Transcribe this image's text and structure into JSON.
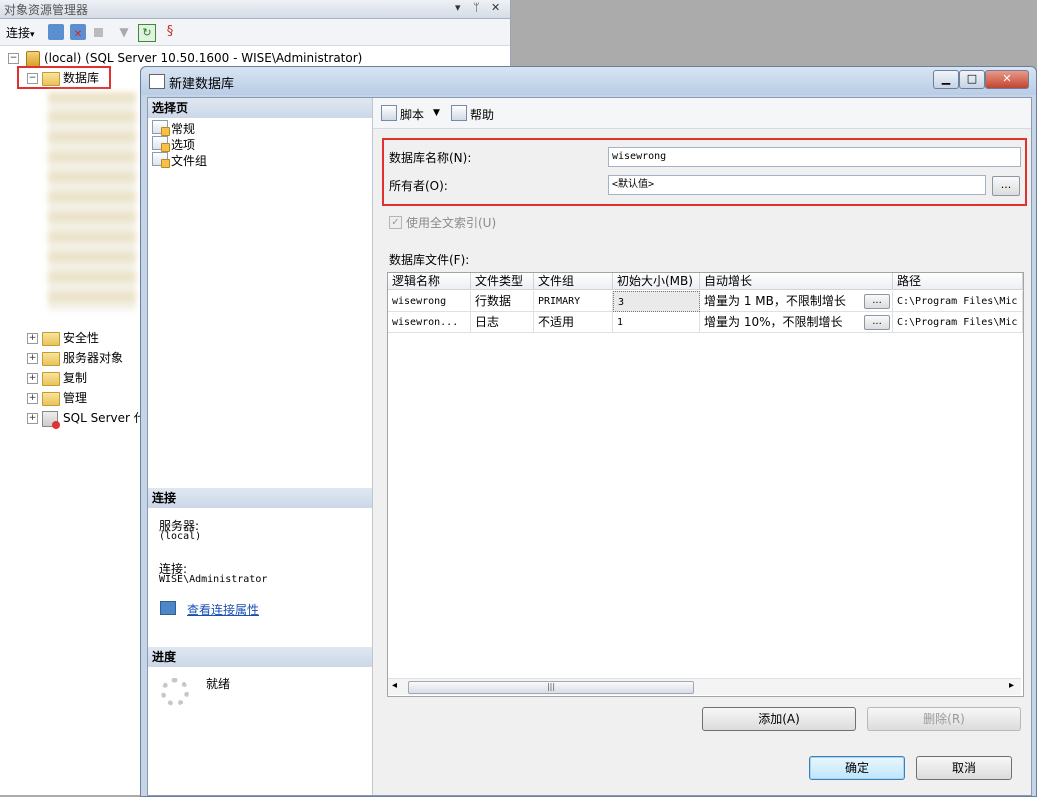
{
  "object_explorer": {
    "title": "对象资源管理器",
    "title_controls": [
      "▾",
      "ᛘ",
      "✕"
    ],
    "toolbar": {
      "connect_label": "连接",
      "connect_arrow": "▾"
    },
    "tree": {
      "server": "(local) (SQL Server 10.50.1600 - WISE\\Administrator)",
      "databases": "数据库",
      "nodes": [
        "安全性",
        "服务器对象",
        "复制",
        "管理",
        "SQL Server 代"
      ]
    }
  },
  "dialog": {
    "title": "新建数据库",
    "window_controls": {
      "minimize": "▁",
      "maximize": "□",
      "close": "✕"
    },
    "select_page": {
      "header": "选择页",
      "items": [
        "常规",
        "选项",
        "文件组"
      ]
    },
    "connection": {
      "header": "连接",
      "server_label": "服务器:",
      "server_value": "(local)",
      "connection_label": "连接:",
      "connection_value": "WISE\\Administrator",
      "view_props_link": "查看连接属性"
    },
    "progress": {
      "header": "进度",
      "status": "就绪"
    },
    "toolbar": {
      "script_label": "脚本",
      "script_arrow": "▼",
      "help_label": "帮助"
    },
    "form": {
      "db_name_label": "数据库名称(N):",
      "db_name_value": "wisewrong",
      "owner_label": "所有者(O):",
      "owner_value": "<默认值>",
      "owner_browse": "...",
      "fulltext_label": "使用全文索引(U)",
      "fulltext_check": "✓",
      "db_files_label": "数据库文件(F):"
    },
    "grid": {
      "columns": [
        "逻辑名称",
        "文件类型",
        "文件组",
        "初始大小(MB)",
        "自动增长",
        "路径"
      ],
      "rows": [
        {
          "logical": "wisewrong",
          "type": "行数据",
          "group": "PRIMARY",
          "size": "3",
          "growth": "增量为 1 MB，不限制增长",
          "browse": "...",
          "path": "C:\\Program Files\\Mic"
        },
        {
          "logical": "wisewron...",
          "type": "日志",
          "group": "不适用",
          "size": "1",
          "growth": "增量为 10%，不限制增长",
          "browse": "...",
          "path": "C:\\Program Files\\Mic"
        }
      ],
      "scroll_left": "◂",
      "scroll_right": "▸",
      "scroll_grip": "|||"
    },
    "buttons": {
      "add": "添加(A)",
      "remove": "删除(R)",
      "ok": "确定",
      "cancel": "取消"
    }
  }
}
